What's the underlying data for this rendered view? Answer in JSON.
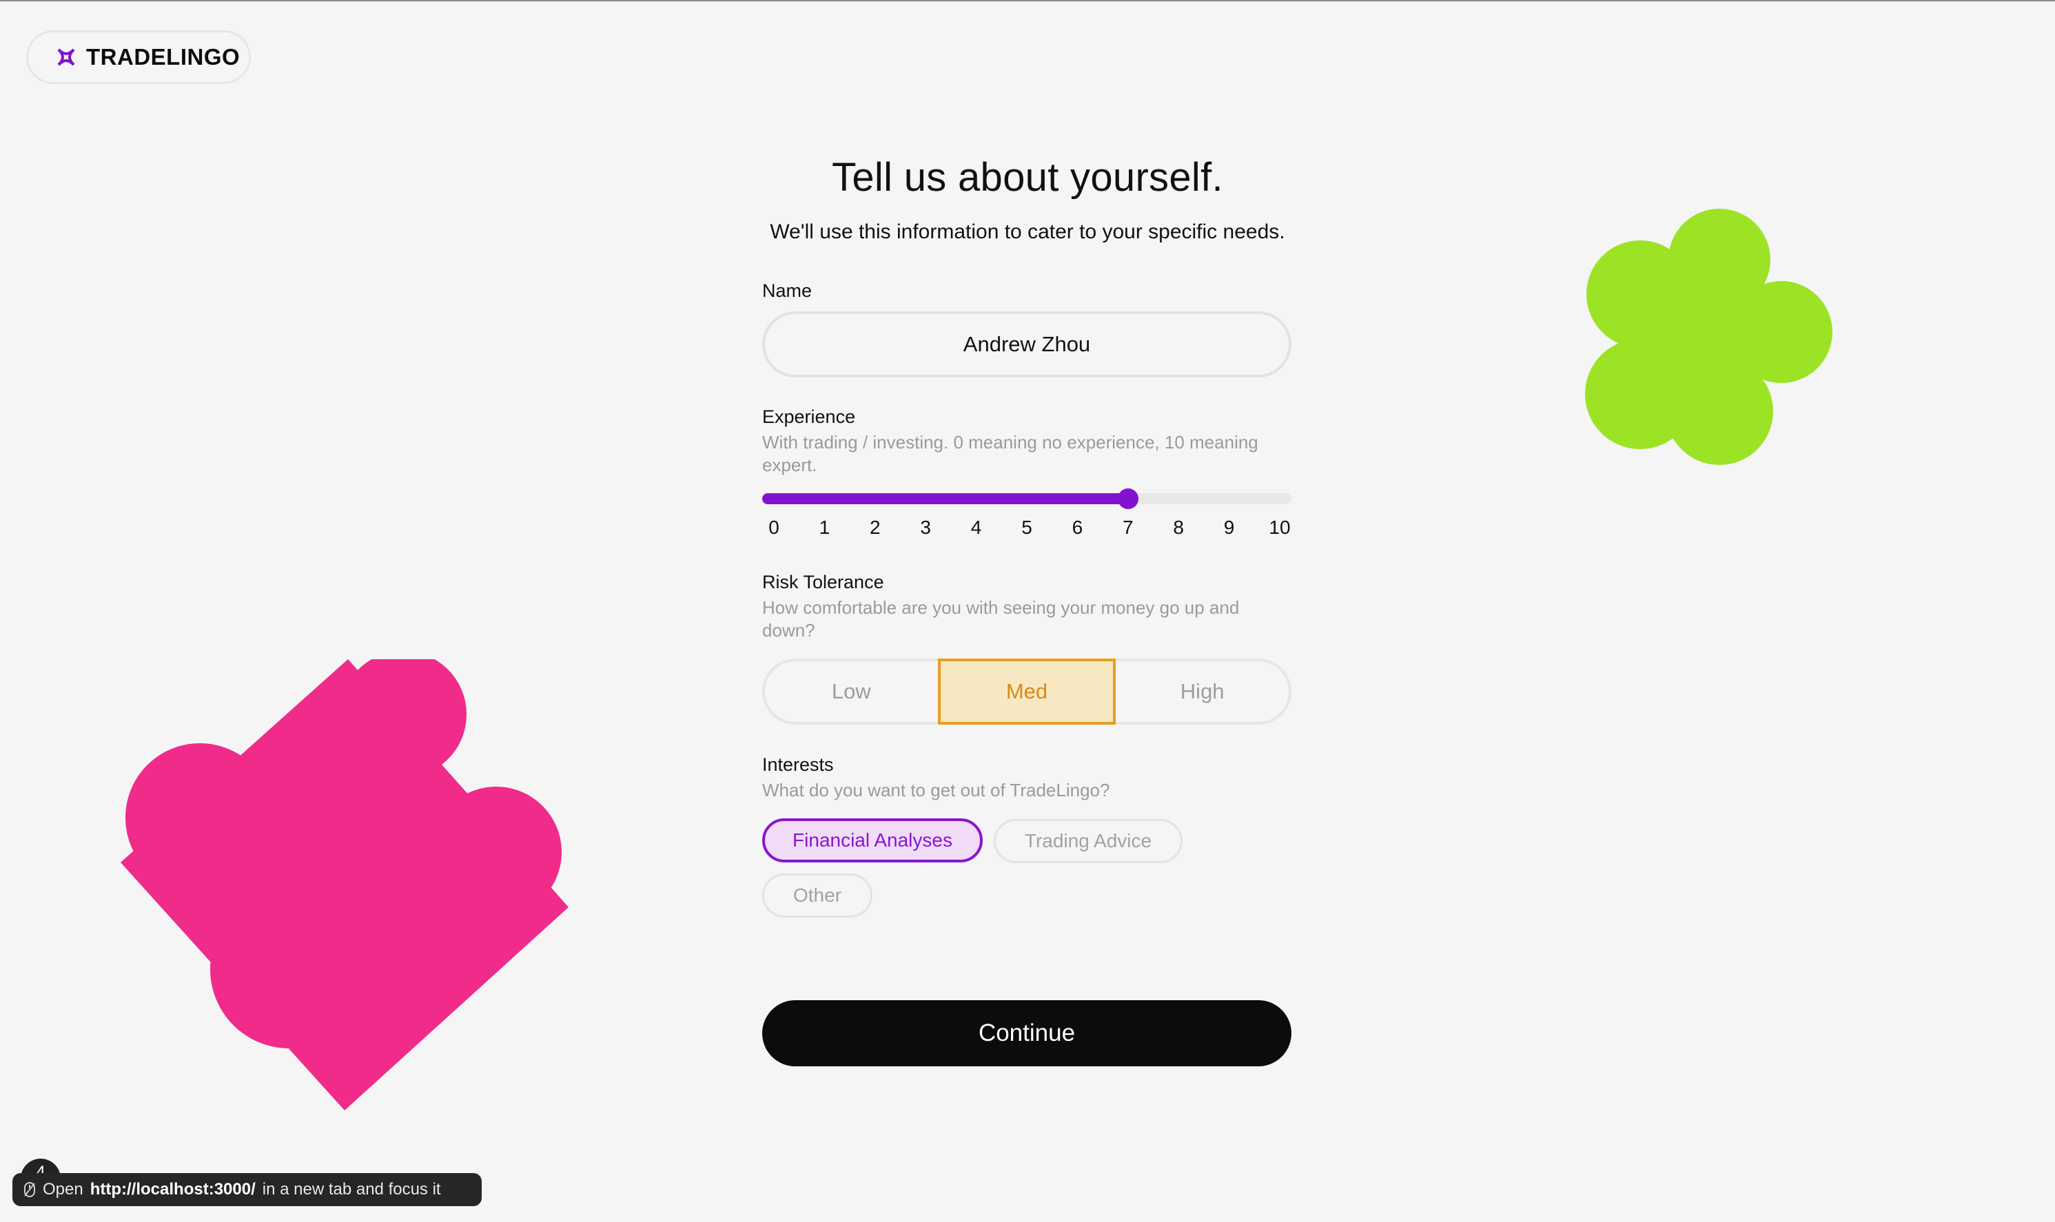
{
  "brand": {
    "name": "TRADELINGO",
    "icon": "knot-logo-icon",
    "color": "#8411cf"
  },
  "header": {
    "title": "Tell us about yourself.",
    "subtitle": "We'll use this information to cater to your specific needs."
  },
  "form": {
    "name": {
      "label": "Name",
      "value": "Andrew Zhou"
    },
    "experience": {
      "label": "Experience",
      "hint": "With trading / investing. 0 meaning no experience, 10 meaning expert.",
      "min": 0,
      "max": 10,
      "value": 7,
      "ticks": [
        "0",
        "1",
        "2",
        "3",
        "4",
        "5",
        "6",
        "7",
        "8",
        "9",
        "10"
      ]
    },
    "risk": {
      "label": "Risk Tolerance",
      "hint": "How comfortable are you with seeing your money go up and down?",
      "options": [
        "Low",
        "Med",
        "High"
      ],
      "selected": "Med"
    },
    "interests": {
      "label": "Interests",
      "hint": "What do you want to get out of TradeLingo?",
      "options": [
        "Financial Analyses",
        "Trading Advice",
        "Other"
      ],
      "selected": [
        "Financial Analyses"
      ]
    },
    "continue_label": "Continue"
  },
  "decor": {
    "flower_color": "#9be324",
    "pink_color": "#f02b8a"
  },
  "toast": {
    "badge": "4",
    "prefix": "Open",
    "url": "http://localhost:3000/",
    "suffix": "in a new tab and focus it",
    "icon": "mouse-icon"
  }
}
